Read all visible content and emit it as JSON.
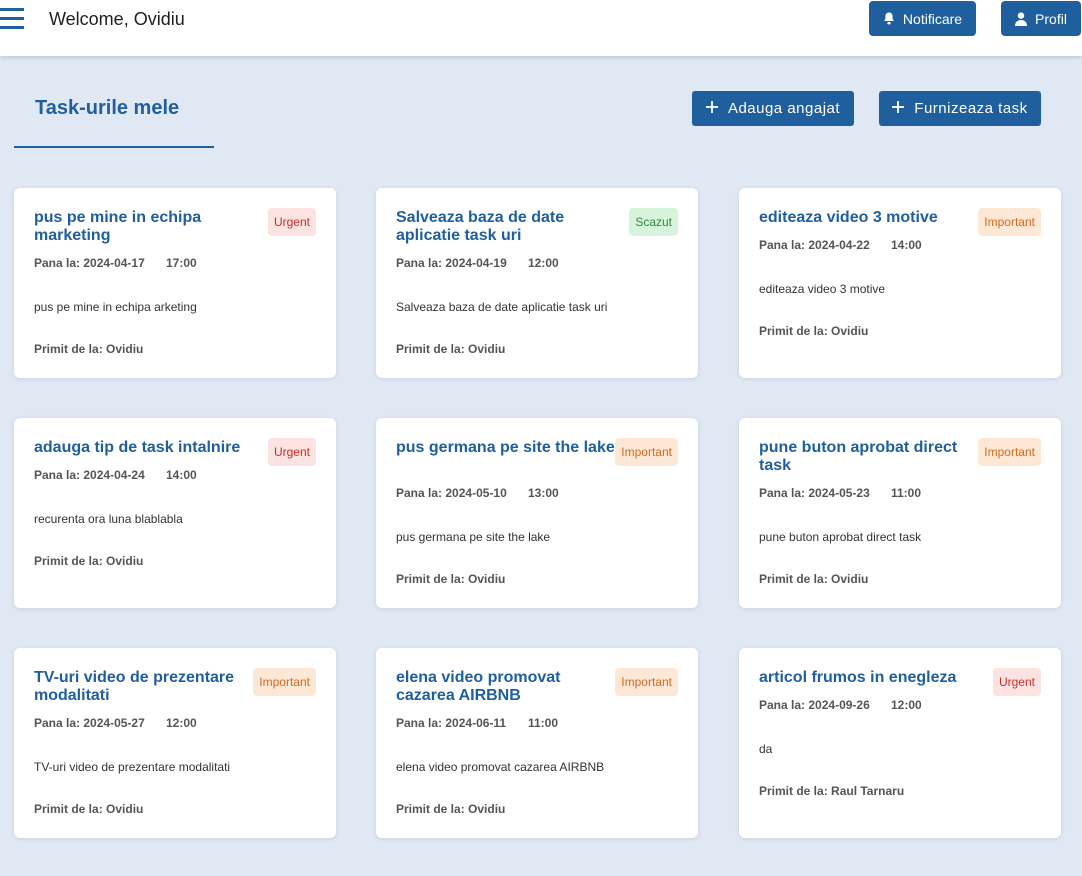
{
  "header": {
    "welcome": "Welcome, Ovidiu",
    "notifications_label": "Notificare",
    "profile_label": "Profil"
  },
  "page": {
    "title": "Task-urile mele",
    "add_employee_label": "Adauga angajat",
    "provide_task_label": "Furnizeaza task"
  },
  "labels": {
    "due": "Pana la:",
    "from": "Primit de la:"
  },
  "colors": {
    "primary": "#1f5f9e",
    "background": "#dfe8f3",
    "urgent_bg": "#fde2e2",
    "urgent_text": "#c8302c",
    "important_bg": "#fde8d6",
    "important_text": "#d2691e",
    "scazut_bg": "#d8f3dc",
    "scazut_text": "#2f8a3f"
  },
  "tasks": [
    {
      "title": "pus pe mine in echipa marketing",
      "priority": "Urgent",
      "date": "2024-04-17",
      "time": "17:00",
      "description": "pus pe mine in echipa arketing",
      "from": "Ovidiu"
    },
    {
      "title": "Salveaza baza de date aplicatie task uri",
      "priority": "Scazut",
      "date": "2024-04-19",
      "time": "12:00",
      "description": "Salveaza baza de date aplicatie task uri",
      "from": "Ovidiu"
    },
    {
      "title": "editeaza video 3 motive",
      "priority": "Important",
      "date": "2024-04-22",
      "time": "14:00",
      "description": "editeaza video 3 motive",
      "from": "Ovidiu"
    },
    {
      "title": "adauga tip de task intalnire",
      "priority": "Urgent",
      "date": "2024-04-24",
      "time": "14:00",
      "description": "recurenta ora luna blablabla",
      "from": "Ovidiu"
    },
    {
      "title": "pus germana pe site the lake",
      "priority": "Important",
      "date": "2024-05-10",
      "time": "13:00",
      "description": "pus germana pe site the lake",
      "from": "Ovidiu"
    },
    {
      "title": "pune buton aprobat direct task",
      "priority": "Important",
      "date": "2024-05-23",
      "time": "11:00",
      "description": "pune buton aprobat direct task",
      "from": "Ovidiu"
    },
    {
      "title": "TV-uri video de prezentare modalitati",
      "priority": "Important",
      "date": "2024-05-27",
      "time": "12:00",
      "description": "TV-uri video de prezentare modalitati",
      "from": "Ovidiu"
    },
    {
      "title": "elena video promovat cazarea AIRBNB",
      "priority": "Important",
      "date": "2024-06-11",
      "time": "11:00",
      "description": "elena video promovat cazarea AIRBNB",
      "from": "Ovidiu"
    },
    {
      "title": "articol frumos in enegleza",
      "priority": "Urgent",
      "date": "2024-09-26",
      "time": "12:00",
      "description": "da",
      "from": "Raul Tarnaru"
    }
  ]
}
